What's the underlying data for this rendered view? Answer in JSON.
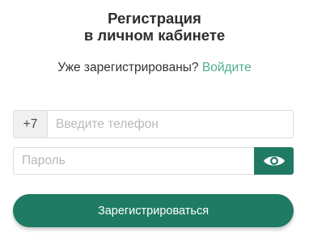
{
  "header": {
    "title_line1": "Регистрация",
    "title_line2": "в личном кабинете"
  },
  "login_prompt": {
    "text": "Уже зарегистрированы?",
    "link": "Войдите"
  },
  "phone": {
    "prefix": "+7",
    "placeholder": "Введите телефон",
    "value": ""
  },
  "password": {
    "placeholder": "Пароль",
    "value": "",
    "toggle_icon": "eye-icon"
  },
  "submit_label": "Зарегистрироваться",
  "colors": {
    "accent": "#1f7b63",
    "link": "#4fae93",
    "prefix_bg": "#f0f0f0",
    "border": "#dcdcdc",
    "placeholder": "#b9b9b9"
  }
}
